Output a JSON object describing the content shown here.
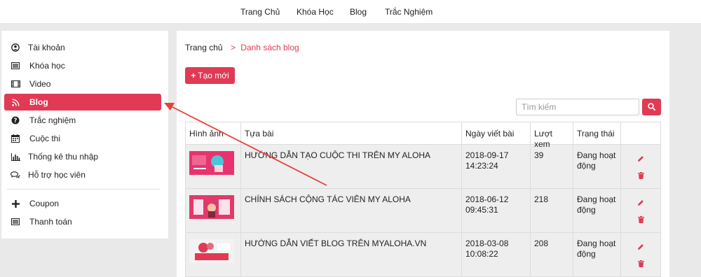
{
  "topnav": {
    "items": [
      "Trang Chủ",
      "Khóa Học",
      "Blog",
      "Trắc Nghiệm"
    ]
  },
  "sidebar": {
    "items": [
      {
        "label": "Tài khoản",
        "icon": "user-circle-icon"
      },
      {
        "label": "Khóa học",
        "icon": "list-icon"
      },
      {
        "label": "Video",
        "icon": "film-icon"
      },
      {
        "label": "Blog",
        "icon": "rss-icon",
        "active": true
      },
      {
        "label": "Trắc nghiệm",
        "icon": "question-circle-icon"
      },
      {
        "label": "Cuộc thi",
        "icon": "calendar-icon"
      },
      {
        "label": "Thống kê thu nhập",
        "icon": "bar-chart-icon"
      },
      {
        "label": "Hỗ trợ học viên",
        "icon": "comments-icon"
      }
    ],
    "extra_items": [
      {
        "label": "Coupon",
        "icon": "plus-icon"
      },
      {
        "label": "Thanh toán",
        "icon": "list-icon"
      }
    ]
  },
  "breadcrumb": {
    "home": "Trang chủ",
    "separator": ">",
    "current": "Danh sách blog"
  },
  "create_button": {
    "icon": "+",
    "label": "Tạo mới"
  },
  "search": {
    "placeholder": "Tìm kiếm"
  },
  "table": {
    "headers": [
      "Hình ảnh",
      "Tựa bài",
      "Ngày viết bài",
      "Lượt xem",
      "Trạng thái",
      ""
    ],
    "rows": [
      {
        "title": "HƯỚNG DẪN TẠO CUỘC THI TRÊN MY ALOHA",
        "date": "2018-09-17",
        "time": "14:23:24",
        "views": "39",
        "status": "Đang hoạt động"
      },
      {
        "title": "CHÍNH SÁCH CỘNG TÁC VIÊN MY ALOHA",
        "date": "2018-06-12",
        "time": "09:45:31",
        "views": "218",
        "status": "Đang hoạt động"
      },
      {
        "title": "HƯỚNG DẪN VIẾT BLOG TRÊN MYALOHA.VN",
        "date": "2018-03-08",
        "time": "10:08:22",
        "views": "208",
        "status": "Đang hoạt động"
      }
    ]
  },
  "colors": {
    "accent": "#e03a55",
    "annotation_arrow": "#e8403a",
    "row_background": "#eeeeee"
  }
}
